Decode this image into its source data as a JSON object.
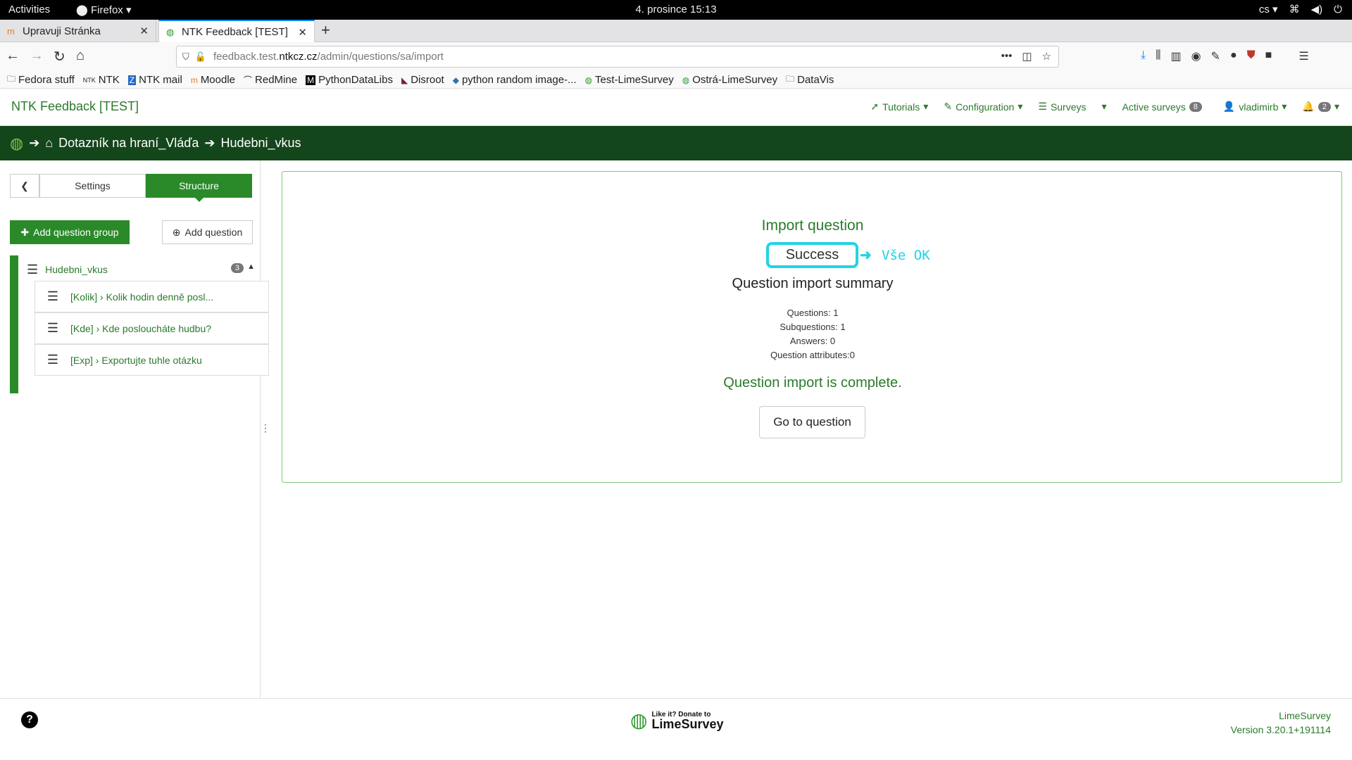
{
  "system": {
    "activities": "Activities",
    "app": "Firefox",
    "clock": "4. prosince  15:13",
    "lang": "cs"
  },
  "tabs": [
    {
      "title": "Upravuji Stránka"
    },
    {
      "title": "NTK Feedback [TEST]"
    }
  ],
  "url": {
    "host_prefix": "feedback.test.",
    "host_main": "ntkcz.cz",
    "path": "/admin/questions/sa/import"
  },
  "bookmarks": [
    "Fedora stuff",
    "NTK",
    "NTK mail",
    "Moodle",
    "RedMine",
    "PythonDataLibs",
    "Disroot",
    "python random image-...",
    "Test-LimeSurvey",
    "Ostrá-LimeSurvey",
    "DataVis"
  ],
  "ls_nav": {
    "brand": "NTK Feedback [TEST]",
    "tutorials": "Tutorials",
    "configuration": "Configuration",
    "surveys": "Surveys",
    "active_surveys": "Active surveys",
    "active_count": "8",
    "user": "vladimirb",
    "notif_count": "2"
  },
  "breadcrumb": {
    "survey": "Dotazník na hraní_Vláďa",
    "group": "Hudebni_vkus"
  },
  "sidebar": {
    "tab_settings": "Settings",
    "tab_structure": "Structure",
    "add_group": "Add question group",
    "add_question": "Add question",
    "group_name": "Hudebni_vkus",
    "group_count": "3",
    "questions": [
      {
        "label": "[Kolik] › Kolik hodin denně posl..."
      },
      {
        "label": "[Kde] › Kde posloucháte hudbu?"
      },
      {
        "label": "[Exp] › Exportujte tuhle otázku"
      }
    ]
  },
  "main": {
    "title": "Import question",
    "success": "Success",
    "annotation": "Vše OK",
    "summary_title": "Question import summary",
    "stats": [
      "Questions: 1",
      "Subquestions: 1",
      "Answers: 0",
      "Question attributes:0"
    ],
    "complete": "Question import is complete.",
    "go_button": "Go to question"
  },
  "footer": {
    "donate_small": "Like it? Donate to",
    "donate_big": "LimeSurvey",
    "brand": "LimeSurvey",
    "version": "Version 3.20.1+191114"
  }
}
